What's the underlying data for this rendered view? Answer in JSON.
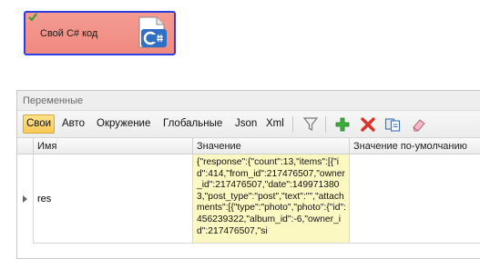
{
  "node": {
    "label": "Свой C# код",
    "status_icon": "check-icon",
    "icon": "csharp-file-icon"
  },
  "panel": {
    "title": "Переменные",
    "tabs": [
      {
        "label": "Свои",
        "active": true
      },
      {
        "label": "Авто",
        "active": false
      },
      {
        "label": "Окружение",
        "active": false
      },
      {
        "label": "Глобальные",
        "active": false
      },
      {
        "label": "Json",
        "active": false
      },
      {
        "label": "Xml",
        "active": false
      }
    ],
    "tools": [
      "filter-icon",
      "add-icon",
      "delete-icon",
      "copy-icon",
      "eraser-icon"
    ],
    "columns": {
      "name": "Имя",
      "value": "Значение",
      "default": "Значение по-умолчанию"
    },
    "rows": [
      {
        "name": "res",
        "value": "{\"response\":{\"count\":13,\"items\":[{\"id\":414,\"from_id\":217476507,\"owner_id\":217476507,\"date\":1499713803,\"post_type\":\"post\",\"text\":\"\",\"attachments\":[{\"type\":\"photo\",\"photo\":{\"id\":456239322,\"album_id\":-6,\"owner_id\":217476507,\"si",
        "default": ""
      }
    ]
  },
  "colors": {
    "node_fill": "#ef8a80",
    "node_border": "#2b3fe0",
    "active_tab": "#f8c955",
    "value_cell": "#fcf8c2"
  }
}
